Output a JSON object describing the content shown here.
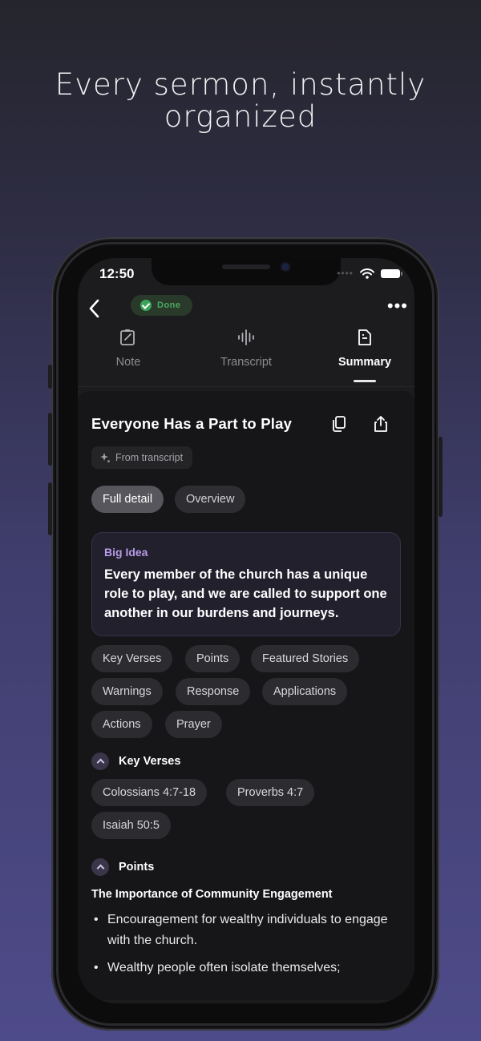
{
  "headline": {
    "line1": "Every sermon, instantly",
    "line2": "organized"
  },
  "status_bar": {
    "time": "12:50"
  },
  "nav": {
    "status_badge": "Done"
  },
  "tabs": [
    {
      "label": "Note",
      "icon": "note-edit-icon"
    },
    {
      "label": "Transcript",
      "icon": "waveform-icon"
    },
    {
      "label": "Summary",
      "icon": "document-icon"
    }
  ],
  "active_tab": "Summary",
  "summary": {
    "title": "Everyone Has a Part to Play",
    "source_chip": "From transcript",
    "view_options": [
      "Full detail",
      "Overview"
    ],
    "selected_view": "Full detail",
    "big_idea": {
      "label": "Big Idea",
      "text": "Every member of the church has a unique role to play, and we are called to support one another in our burdens and journeys."
    },
    "section_chips": [
      "Key Verses",
      "Points",
      "Featured Stories",
      "Warnings",
      "Response",
      "Applications",
      "Actions",
      "Prayer"
    ],
    "key_verses": {
      "heading": "Key Verses",
      "verses": [
        "Colossians 4:7-18",
        "Proverbs 4:7",
        "Isaiah 50:5"
      ]
    },
    "points": {
      "heading": "Points",
      "subheading": "The Importance of Community Engagement",
      "bullets": [
        "Encouragement for wealthy individuals to engage with the church.",
        "Wealthy people often isolate themselves;"
      ]
    }
  },
  "colors": {
    "accent_purple": "#b79ae6",
    "done_green": "#4aa860",
    "screen_bg": "#1c1c1e"
  }
}
